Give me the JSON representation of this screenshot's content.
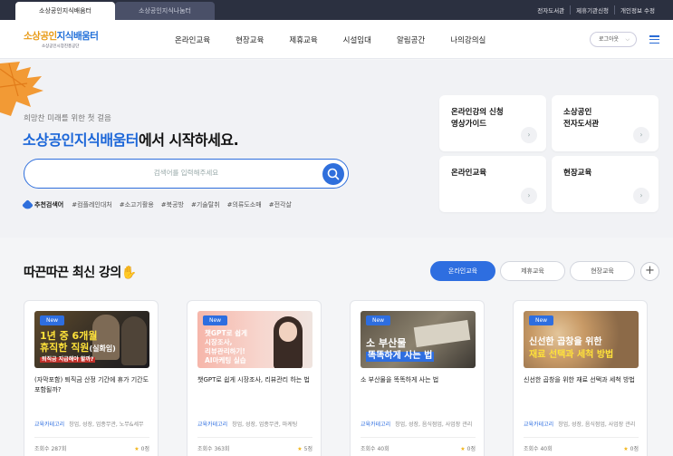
{
  "site_tabs": [
    "소상공인지식배움터",
    "소상공인지식나눔터"
  ],
  "top_links": [
    "전자도서관",
    "제휴기관신청",
    "개인정보 수정"
  ],
  "logo": {
    "main_a": "소상공인",
    "main_b": "지식배움터",
    "sub": "소상공인시장진흥공단"
  },
  "nav": [
    "온라인교육",
    "현장교육",
    "제휴교육",
    "시설임대",
    "알림공간",
    "나의강의실"
  ],
  "logout_label": "로그아웃",
  "hero": {
    "slogan": "희망찬 미래를 위한 첫 걸음",
    "headline_brand": "소상공인지식배움터",
    "headline_rest": "에서 시작하세요.",
    "search_placeholder": "검색어를 입력해주세요",
    "reco_label": "추천검색어",
    "reco_tags": [
      "#컴플레인대처",
      "#소고기활용",
      "#북공방",
      "#기술탈취",
      "#의류도소매",
      "#전각살"
    ]
  },
  "quick_cards": [
    {
      "label": "온라인강의 신청\n영상가이드"
    },
    {
      "label": "소상공인\n전자도서관"
    },
    {
      "label": "온라인교육"
    },
    {
      "label": "현장교육"
    }
  ],
  "section": {
    "title": "따끈따끈 최신 강의",
    "hand": "✋",
    "filters": [
      "온라인교육",
      "제휴교육",
      "현장교육"
    ],
    "active_filter": "온라인교육"
  },
  "courses": [
    {
      "badge": "New",
      "thumb_text_a": "1년 중 6개월",
      "thumb_text_b": "휴직한 직원",
      "thumb_text_c": "(실화임)",
      "thumb_text_d": "퇴직금 지급해야 할까?",
      "title": "(자막포함) 퇴직금 산정 기간에 휴가 기간도 포함될까?",
      "category_label": "교육카테고리",
      "category": "창업, 성장, 업종무관, 노무&세무",
      "views": "조회수 287회",
      "rating": "0점"
    },
    {
      "badge": "New",
      "thumb_text_a": "챗GPT로 쉽게",
      "thumb_text_b": "시장조사,",
      "thumb_text_c": "리뷰관리하기!",
      "thumb_text_d": "AI마케팅 실습",
      "title": "챗GPT로 쉽게 시장조사, 리뷰관리 하는 법",
      "category_label": "교육카테고리",
      "category": "창업, 성장, 업종무관, 마케팅",
      "views": "조회수 363회",
      "rating": "5점"
    },
    {
      "badge": "New",
      "thumb_text_a": "소 부산물",
      "thumb_text_b": "똑똑하게 사는 법",
      "title": "소 부산물을 똑똑하게 사는 법",
      "category_label": "교육카테고리",
      "category": "창업, 성장, 음식점업, 사업장 관리",
      "views": "조회수 40회",
      "rating": "0점"
    },
    {
      "badge": "New",
      "thumb_text_a": "신선한 곱창을 위한",
      "thumb_text_b": "재료 선택과 세척 방법",
      "title": "신선한 곱창을 위한 재료 선택과 세척 방법",
      "category_label": "교육카테고리",
      "category": "창업, 성장, 음식점업, 사업장 관리",
      "views": "조회수 40회",
      "rating": "0점"
    }
  ],
  "colors": {
    "brand_blue": "#2e6ee0",
    "logo_orange": "#e89a16",
    "star": "#f2b416"
  }
}
